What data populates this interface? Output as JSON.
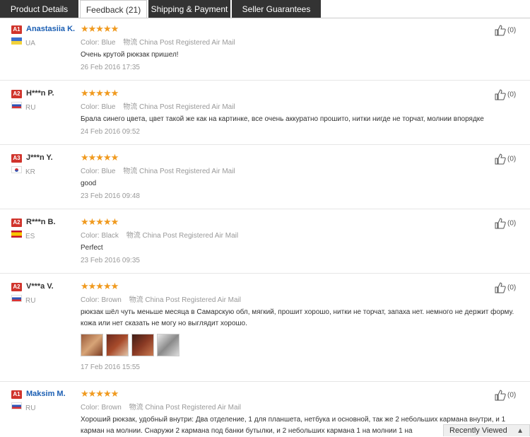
{
  "tabs": [
    {
      "label": "Product Details"
    },
    {
      "label": "Feedback (21)"
    },
    {
      "label": "Shipping & Payment"
    },
    {
      "label": "Seller Guarantees"
    }
  ],
  "reviews": [
    {
      "badge": "A1",
      "name": "Anastasiia K.",
      "country": "UA",
      "stars": "★★★★★",
      "color_label": "Color:",
      "color": "Blue",
      "shipping_label": "物流",
      "shipping": "China Post Registered Air Mail",
      "text": "Очень крутой рюкзак пришел!",
      "date": "26 Feb 2016 17:35",
      "helpful": "(0)"
    },
    {
      "badge": "A2",
      "name": "H***n P.",
      "country": "RU",
      "stars": "★★★★★",
      "color_label": "Color:",
      "color": "Blue",
      "shipping_label": "物流",
      "shipping": "China Post Registered Air Mail",
      "text": "Брала синего цвета, цвет такой же как на картинке, все очень аккуратно прошито, нитки нигде не торчат, молнии впорядке",
      "date": "24 Feb 2016 09:52",
      "helpful": "(0)"
    },
    {
      "badge": "A3",
      "name": "J***n Y.",
      "country": "KR",
      "stars": "★★★★★",
      "color_label": "Color:",
      "color": "Blue",
      "shipping_label": "物流",
      "shipping": "China Post Registered Air Mail",
      "text": "good",
      "date": "23 Feb 2016 09:48",
      "helpful": "(0)"
    },
    {
      "badge": "A2",
      "name": "R***n B.",
      "country": "ES",
      "stars": "★★★★★",
      "color_label": "Color:",
      "color": "Black",
      "shipping_label": "物流",
      "shipping": "China Post Registered Air Mail",
      "text": "Perfect",
      "date": "23 Feb 2016 09:35",
      "helpful": "(0)"
    },
    {
      "badge": "A2",
      "name": "V***a V.",
      "country": "RU",
      "stars": "★★★★★",
      "color_label": "Color:",
      "color": "Brown",
      "shipping_label": "物流",
      "shipping": "China Post Registered Air Mail",
      "text": "рюкзак шёл чуть меньше месяца в Самарскую обл, мягкий, прошит хорошо, нитки не торчат, запаха нет. немного не держит форму. кожа или нет сказать не могу но выглядит хорошо.",
      "date": "17 Feb 2016 15:55",
      "helpful": "(0)"
    },
    {
      "badge": "A1",
      "name": "Maksim M.",
      "country": "RU",
      "stars": "★★★★★",
      "color_label": "Color:",
      "color": "Brown",
      "shipping_label": "物流",
      "shipping": "China Post Registered Air Mail",
      "text": "Хороший рюкзак, удобный внутри: Два отделение, 1 для планшета, нетбука и основной, так же 2 небольших кармана внутри, и 1 карман на молнии. Снаружи 2 кармана под банки бутылки, и 2 небольших кармана 1 на молнии 1 на",
      "date": "",
      "helpful": "(0)"
    }
  ],
  "recently_viewed": {
    "label": "Recently Viewed"
  }
}
